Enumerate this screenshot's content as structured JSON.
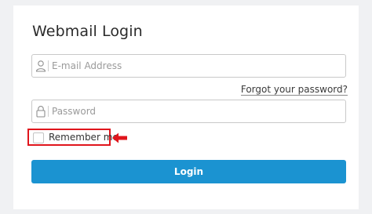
{
  "login_card": {
    "title": "Webmail Login",
    "email_field": {
      "placeholder": "E-mail Address",
      "value": "",
      "icon": "user-icon"
    },
    "forgot_password_link": "Forgot your password?",
    "password_field": {
      "placeholder": "Password",
      "value": "",
      "icon": "lock-icon"
    },
    "remember_me": {
      "label": "Remember me",
      "checked": false
    },
    "login_button": "Login"
  },
  "colors": {
    "accent": "#1b93d1",
    "highlight": "#e0151c",
    "background": "#f0f1f3",
    "card": "#ffffff"
  },
  "annotation": {
    "highlight_box_icon": "red-outline-box",
    "arrow_icon": "red-arrow-left-icon"
  }
}
